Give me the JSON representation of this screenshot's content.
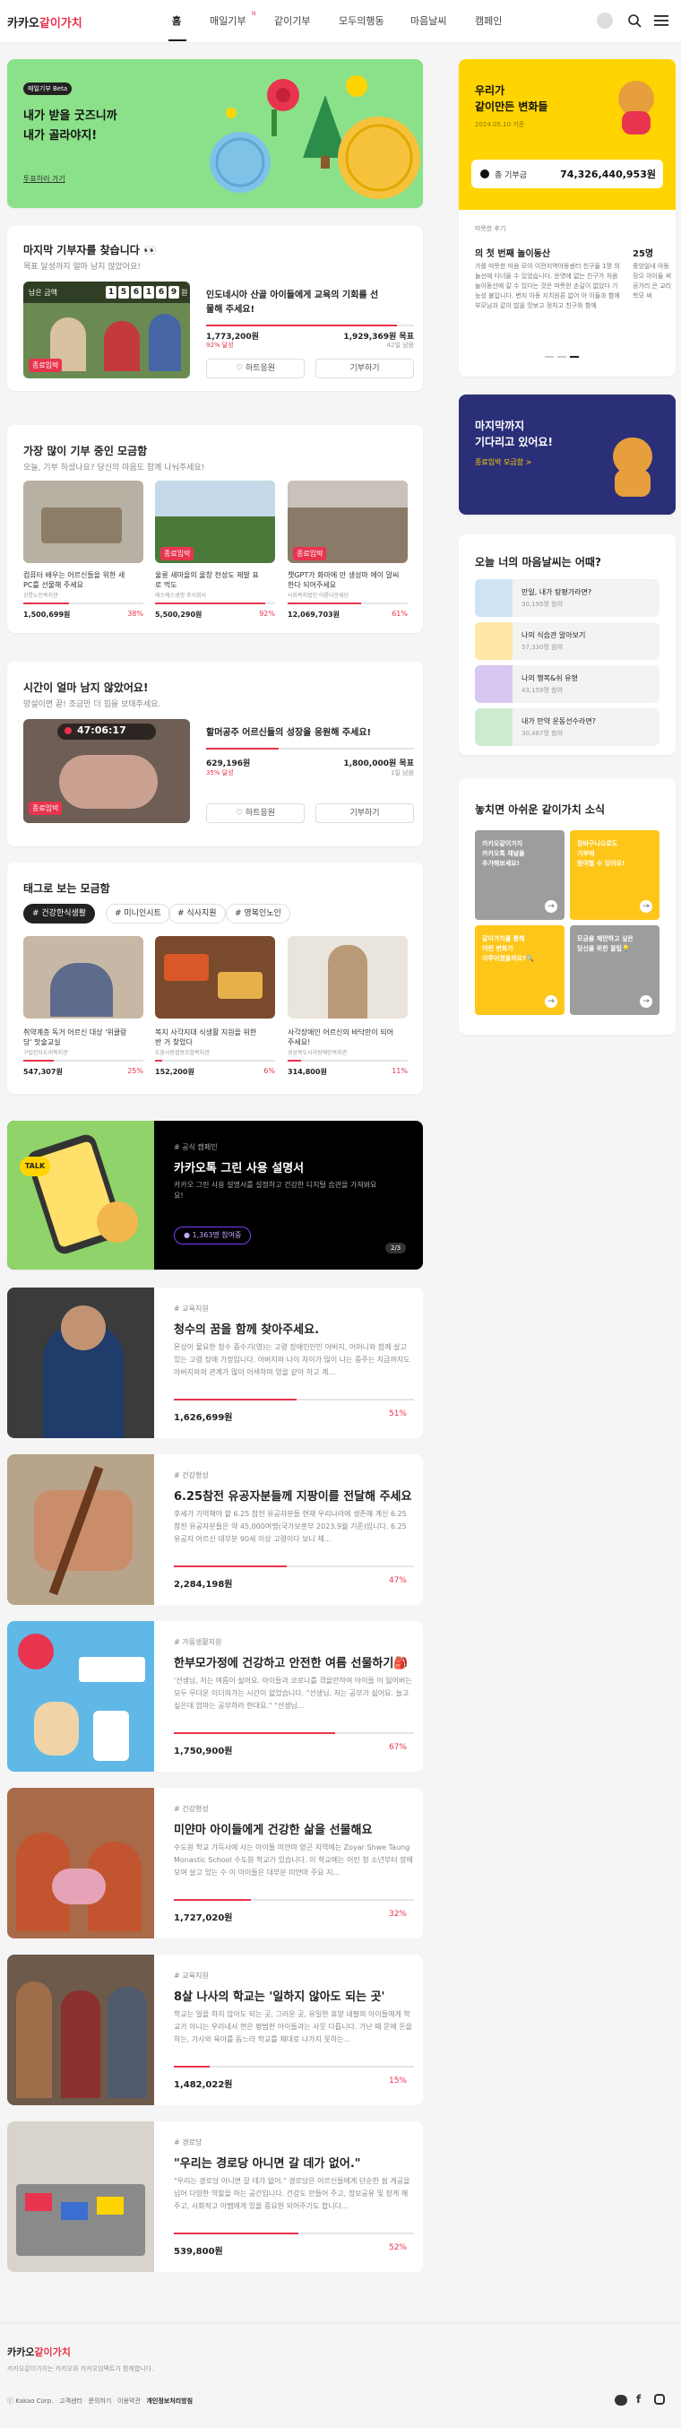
{
  "header": {
    "logo_main": "카카오",
    "logo_accent": "같이가치",
    "nav": [
      "홈",
      "매일기부",
      "같이기부",
      "모두의행동",
      "마음날씨",
      "캠페인"
    ],
    "nav_daily_badge": "N"
  },
  "banner": {
    "tag": "매일기부 Beta",
    "title1": "내가 받을 굿즈니까",
    "title2": "내가 골라야지!",
    "link": "투표하러 가기"
  },
  "last": {
    "title": "마지막 기부자를 찾습니다 👀",
    "subtitle": "목표 달성까지 얼마 남지 않았어요!",
    "timer_label": "남은 금액",
    "timer_digits": [
      "1",
      "5",
      "6",
      "1",
      "6",
      "9"
    ],
    "timer_unit": "원",
    "badge": "종료임박",
    "item_title1": "인도네시아 산골 아이들에게 교육의 기회를 선",
    "item_title2": "물해 주세요!",
    "raised": "1,773,200원",
    "goal": "1,929,369원 목표",
    "pct": "92% 달성",
    "days": "42일 남음",
    "progress": 92,
    "btn_cheer": "하트응원",
    "btn_donate": "기부하기"
  },
  "popular": {
    "title": "가장 많이 기부 중인 모금함",
    "subtitle": "오늘, 기부 하셨나요? 당신의 마음도 함께 나눠주세요!",
    "items": [
      {
        "title1": "컴퓨터 배우는 어르신들을 위한 새",
        "title2": "PC를 선물해 주세요",
        "org": "강릉노인복지관",
        "amount": "1,500,699원",
        "pct": "38%",
        "progress": 38,
        "badge": ""
      },
      {
        "title1": "울릉 새마을의 울창 천성도 제발 표",
        "title2": "로 먹도",
        "org": "에스에스생명 주식회사",
        "amount": "5,500,290원",
        "pct": "92%",
        "progress": 92,
        "badge": "종료임박"
      },
      {
        "title1": "챗GPT가 화마에 만 생성마 에이 말씨",
        "title2": "한다 되어주세요",
        "org": "사회복지법인 아름다운재단",
        "amount": "12,069,703원",
        "pct": "61%",
        "progress": 61,
        "badge": "종료임박"
      }
    ]
  },
  "time": {
    "title": "시간이 얼마 남지 않았어요!",
    "subtitle": "망설이면 끝! 조금만 더 힘을 보태주세요.",
    "timer": "47:06:17",
    "badge": "종료임박",
    "item_title": "할머공주 어르신들의 성장을 응원해 주세요!",
    "raised": "629,196원",
    "goal": "1,800,000원 목표",
    "pct": "35% 달성",
    "days": "1일 남음",
    "progress": 35,
    "btn_cheer": "하트응원",
    "btn_donate": "기부하기"
  },
  "tags": {
    "title": "태그로 보는 모금함",
    "chips": [
      "# 건강한식생활",
      "# 미니인시트",
      "# 식사지원",
      "# 영복인노인"
    ],
    "items": [
      {
        "title1": "취약계층 독거 어르신 대상 '위클랑",
        "title2": "당' 맛술교실",
        "org": "구립인다도리복지관",
        "amount": "547,307원",
        "pct": "25%",
        "progress": 25
      },
      {
        "title1": "복지 사각지대 식생활 지원을 위한",
        "title2": "반 거 찾았다",
        "org": "도움사랑협동조합복지관",
        "amount": "152,200원",
        "pct": "6%",
        "progress": 6
      },
      {
        "title1": "사각장애인 어르신의 바닥만이 되어",
        "title2": "주세요!",
        "org": "경상북도사각장애인복지관",
        "amount": "314,800원",
        "pct": "11%",
        "progress": 11
      }
    ]
  },
  "promo": {
    "cat": "# 공식 캠페인",
    "title": "카카오톡 그린 사용 설명서",
    "desc1": "카카오 그린 사용 설명서를 설정하고 건강한 디지털 습관을 가져봐요",
    "desc2": "요!",
    "count": "1,363명 참여중",
    "page": "2/3"
  },
  "list": [
    {
      "cat": "# 교육지원",
      "title": "청수의 꿈을 함께 찾아주세요.",
      "desc": "몬상이 물요한 청수 중수기(영)는 고령 장애인인인 아버지, 어머니와 함께 살고 있는 고령 장애 가정입니다. 아버지와 나이 차이가 많이 나는 중주는 지금까지도 아버지와의 관계가 많이 어색하며 영을 같아 하고 계...",
      "amount": "1,626,699원",
      "pct": "51%",
      "progress": 51
    },
    {
      "cat": "# 건강형성",
      "title": "6.25참전 유공자분들께 지팡이를 전달해 주세요",
      "desc": "후세가 기억해야 할 6.25 참전 유공자분들 현재 우리나라에 생존해 계신 6.25 참전 유공자분들은 약 45,000여명(국가보훈부 2023.9월 기준)입니다. 6.25 유공자 어르신 대부분 90세 이상 고령이다 보니 체...",
      "amount": "2,284,198원",
      "pct": "47%",
      "progress": 47
    },
    {
      "cat": "# 가뭄생활지원",
      "title": "한부모가정에 건강하고 안전한 여름 선물하기🎒",
      "desc": "'선생님, 저는 여름이 싫어요. 아이들과 코로나를 겪을만하여 아이들 이 잃어버는 모두 무더운 이더의가는 시간이 없었습니다. \"선생님, 저는 공부가 싫어요. 늘고 싶은데 엄마는 공부하라 한대요.\" \"선생님...",
      "amount": "1,750,900원",
      "pct": "67%",
      "progress": 67
    },
    {
      "cat": "# 건강형성",
      "title": "미얀마 아이들에게 건강한 삶을 선물해요",
      "desc": "수도원 학교 가득사에 사는 아이들 미얀마 양곤 지역에는 Zoyar Shwe Taung Monastic School 수도원 학교가 있습니다. 이 학교에는 어린 청 소년부터 장에 모여 살고 있는 수 이 아이들은 대부분 미얀마 주요 지...",
      "amount": "1,727,020원",
      "pct": "32%",
      "progress": 32
    },
    {
      "cat": "# 교육지원",
      "title": "8살 나사의 학교는 '일하지 않아도 되는 곳'",
      "desc": "학교는 일을 하지 않아도 되는 곳, 그러운 곳, 유일한 휴양 네팔의 아이들에게 학교가 아니는 우라네서 현은 평범한 아이들과는 사뭇 다릅니다. 가난 때 문에 돈을 하는, 가사와 육아를 돕느라 학교를 제대로 나가지 못하는...",
      "amount": "1,482,022원",
      "pct": "15%",
      "progress": 15
    },
    {
      "cat": "# 경로당",
      "title": "\"우리는 경로당 아니면 갈 데가 없어.\"",
      "desc": "\"우리는 경로당 아니면 갈 데가 없어.\" 경로당은 어르신들에게 단순한 쉼 게공을 넘어 다양한 역할을 하는 공간입니다. 건강도 만들어 주고, 정보공유 및 장게 해 주고, 사회적고 아쨉에게 있을 중요한 되어주기도 합니다...",
      "amount": "539,800원",
      "pct": "52%",
      "progress": 52
    }
  ],
  "side_top": {
    "title1": "우리가",
    "title2": "같이만든 변화들",
    "date": "2024.05.10 기준",
    "total_label": "총 기부금",
    "total_value": "74,326,440,953원",
    "review_label": "따뜻한 후기",
    "story1_title": "의 첫 번째 놀이동산",
    "story2_title": "25명 ",
    "story1_text": "가를 따뜻한 마음 모아 이전지역아동센터 친구들 1명 의 놀선에 다녀올 수 있었습니다. 운영에 없는 친구가 처음 놀이동산에 갈 수 있다는 것은 따뜻한 손길이 없었다 기능성 불입니다. 변지 아동 지치원론 없어 아 이들과 함께 부모님과 같이 밥을 맛보고 정처고 친구와 함께",
    "story2_text": "중앙일내 아동 장으 아이들 써 공가리 은 교리 학모 써"
  },
  "side_end": {
    "title1": "마지막까지",
    "title2": "기다리고 있어요!",
    "link": "종료임박 모금함 >"
  },
  "weather": {
    "title": "오늘 너의 마음날씨는 어때?",
    "items": [
      {
        "t": "만일, 내가 탕평가라면?",
        "c": "30,195명 참여"
      },
      {
        "t": "나의 식습관 알아보기",
        "c": "57,330명 참여"
      },
      {
        "t": "나의 행복&쉬 유형",
        "c": "43,159명 참여"
      },
      {
        "t": "내가 만약 운동선수라면?",
        "c": "30,467명 참여"
      }
    ]
  },
  "news": {
    "title": "놓치면 아쉬운 같이가치 소식",
    "tiles": [
      {
        "t": "카카오같이가치\n카카오톡 채널을\n추가해보세요!"
      },
      {
        "t": "장바구니으로도\n기부에\n참여할 수 있어요!"
      },
      {
        "t": "같이가치를 통해\n어떤 변화가\n이루어졌을까요?🔍"
      },
      {
        "t": "모금을 제안하고 싶은\n당신을 위한 꿀팁💡"
      }
    ]
  },
  "footer": {
    "logo_main": "카카오",
    "logo_accent": "같이가치",
    "desc": "카카오같이가치는 카카오와 카카오임팩트가 함께합니다.",
    "links": [
      "ⓒ Kakao Corp.",
      "고객센터",
      "문의하기",
      "이용약관",
      "개인정보처리방침"
    ]
  },
  "colors": {
    "brand": "#e8344e",
    "yellow": "#ffd400",
    "navy": "#2b2f78",
    "green_banner": "#8be189"
  }
}
